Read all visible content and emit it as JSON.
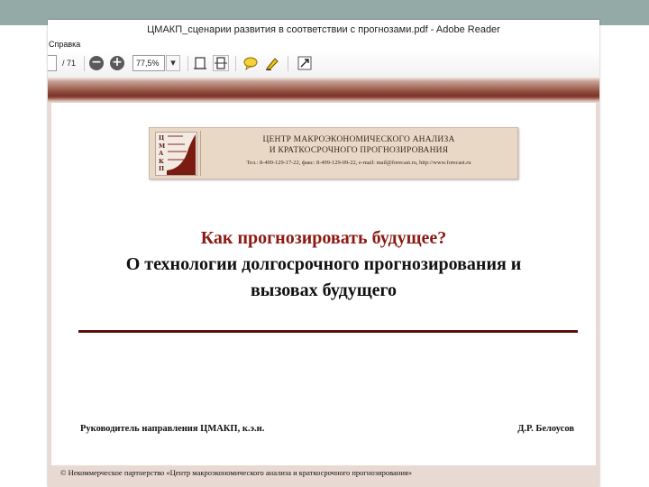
{
  "window": {
    "title": "ЦМАКП_сценарии развития в соответствии с прогнозами.pdf - Adobe Reader"
  },
  "menubar": {
    "items": [
      "Справка"
    ]
  },
  "toolbar": {
    "page_current": "",
    "page_total": "/ 71",
    "zoom_out_glyph": "−",
    "zoom_in_glyph": "+",
    "zoom_value": "77,5%",
    "zoom_dropdown_glyph": "▾",
    "icons": [
      "fit-page-icon",
      "fit-width-icon",
      "comment-icon",
      "highlight-pen-icon",
      "expand-icon"
    ]
  },
  "document": {
    "header": {
      "logo_letters": [
        "Ц",
        "М",
        "А",
        "К",
        "П"
      ],
      "org_name_line1": "ЦЕНТР МАКРОЭКОНОМИЧЕСКОГО АНАЛИЗА",
      "org_name_line2": "И КРАТКОСРОЧНОГО ПРОГНОЗИРОВАНИЯ",
      "contacts": "Тел.: 8-499-129-17-22, факс: 8-499-129-09-22, e-mail: mail@forecast.ru, http://www.forecast.ru"
    },
    "question_title": "Как прогнозировать будущее?",
    "subtitle_line1": "О технологии долгосрочного прогнозирования и",
    "subtitle_line2": "вызовах будущего",
    "author_role": "Руководитель направления ЦМАКП, к.э.н.",
    "author_name": "Д.Р. Белоусов",
    "footer": "© Некоммерческое партнерство «Центр макроэкономического анализа и краткосрочного прогнозирования»"
  },
  "colors": {
    "accent_title": "#8b1a14",
    "rule": "#5a0f0a",
    "logo_background": "#ead8c7",
    "slide_bar": "#94aaa7"
  }
}
